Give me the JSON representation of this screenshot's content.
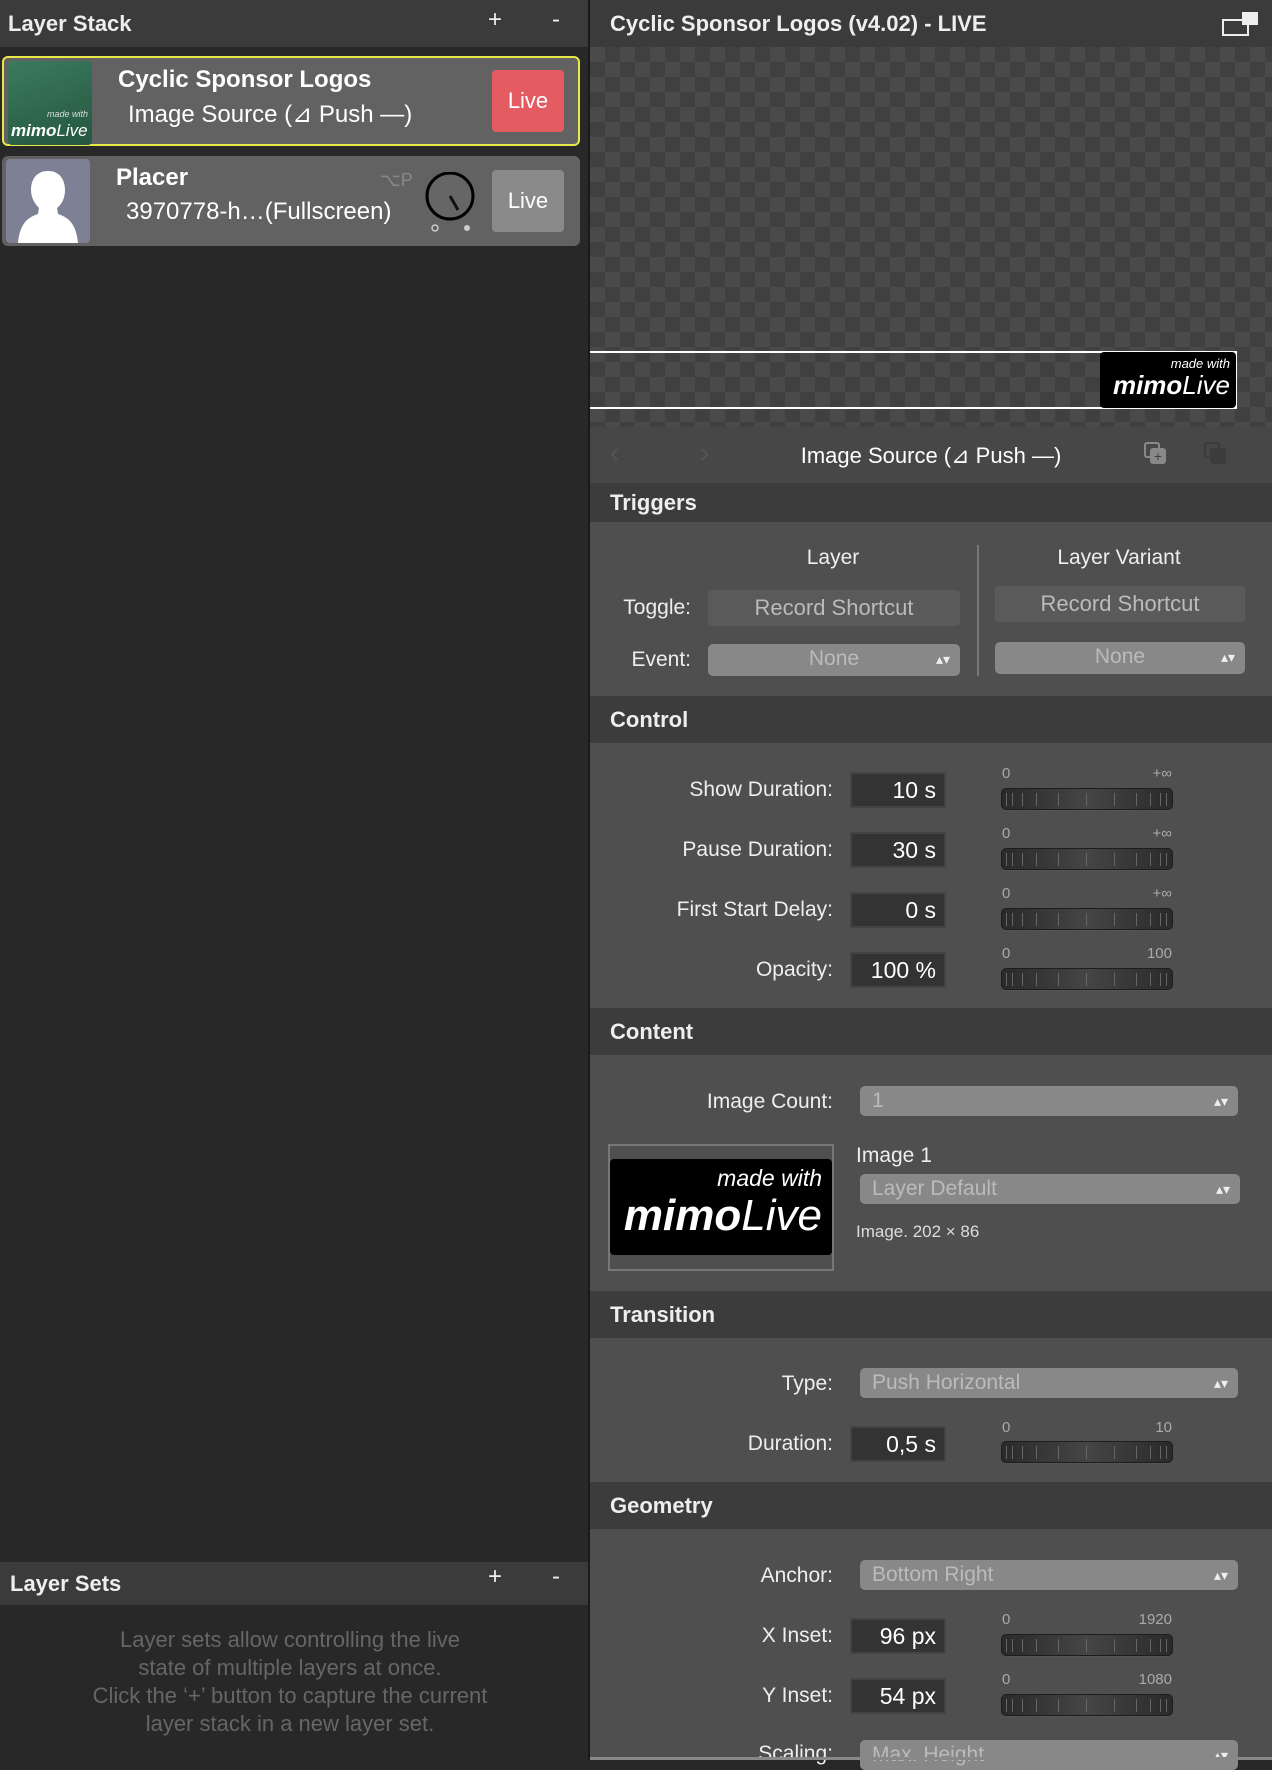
{
  "layer_stack": {
    "title": "Layer Stack",
    "add": "+",
    "remove": "-",
    "layers": [
      {
        "name": "Cyclic Sponsor Logos",
        "subtitle": "Image Source (⊿ Push —)",
        "live": "Live",
        "thumb_top": "made with",
        "thumb_brand_a": "mimo",
        "thumb_brand_b": "Live",
        "live_color": "#e55b62"
      },
      {
        "name": "Placer",
        "subtitle": "3970778-h…(Fullscreen)",
        "shortcut": "⌥P",
        "live": "Live",
        "live_color": "#8a8a8a"
      }
    ]
  },
  "layer_sets": {
    "title": "Layer Sets",
    "add": "+",
    "remove": "-",
    "empty_lines": [
      "Layer sets allow controlling the live",
      "state of multiple layers at once.",
      "Click the ‘+’ button to capture the current",
      "layer stack in a new layer set."
    ]
  },
  "inspector": {
    "title": "Cyclic Sponsor Logos (v4.02) - LIVE",
    "preview_logo": {
      "top": "made with",
      "brand_a": "mimo",
      "brand_b": "Live"
    },
    "nav_title": "Image Source (⊿ Push —)",
    "triggers": {
      "title": "Triggers",
      "col_layer": "Layer",
      "col_variant": "Layer Variant",
      "toggle_label": "Toggle:",
      "event_label": "Event:",
      "record_shortcut": "Record Shortcut",
      "layer_event": "None",
      "variant_event": "None"
    },
    "control": {
      "title": "Control",
      "rows": [
        {
          "label": "Show Duration:",
          "value": "10 s",
          "min": "0",
          "max": "+∞"
        },
        {
          "label": "Pause Duration:",
          "value": "30 s",
          "min": "0",
          "max": "+∞"
        },
        {
          "label": "First Start Delay:",
          "value": "0 s",
          "min": "0",
          "max": "+∞"
        },
        {
          "label": "Opacity:",
          "value": "100 %",
          "min": "0",
          "max": "100"
        }
      ]
    },
    "content": {
      "title": "Content",
      "image_count_label": "Image Count:",
      "image_count": "1",
      "image1_label": "Image 1",
      "image1_source": "Layer Default",
      "image1_info": "Image. 202 × 86",
      "thumb": {
        "top": "made with",
        "brand_a": "mimo",
        "brand_b": "Live"
      }
    },
    "transition": {
      "title": "Transition",
      "type_label": "Type:",
      "type": "Push Horizontal",
      "duration_label": "Duration:",
      "duration": "0,5 s",
      "min": "0",
      "max": "10"
    },
    "geometry": {
      "title": "Geometry",
      "anchor_label": "Anchor:",
      "anchor": "Bottom Right",
      "x_label": "X Inset:",
      "x": "96 px",
      "x_min": "0",
      "x_max": "1920",
      "y_label": "Y Inset:",
      "y": "54 px",
      "y_min": "0",
      "y_max": "1080",
      "scaling_label": "Scaling:",
      "scaling": "Max. Height"
    }
  }
}
